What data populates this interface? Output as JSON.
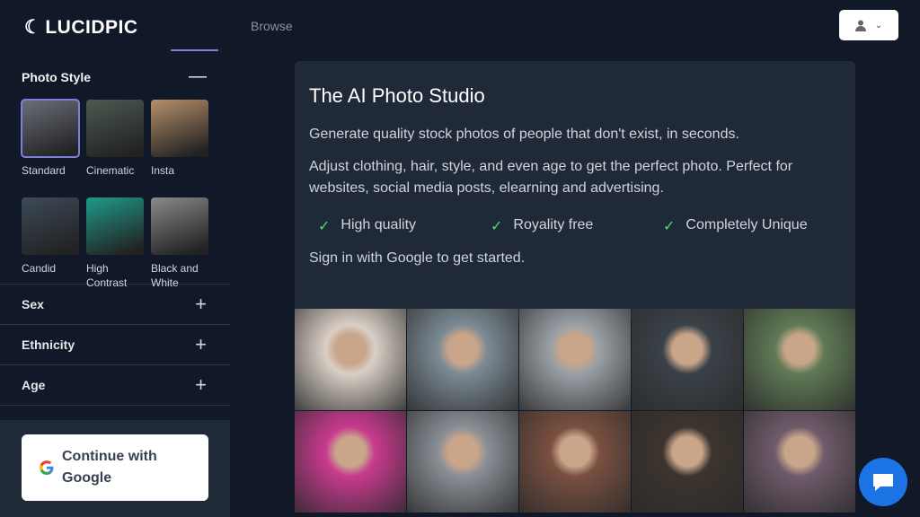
{
  "header": {
    "logo": "LUCIDPIC",
    "nav_browse": "Browse",
    "user_icon": "user-icon"
  },
  "sidebar": {
    "photo_style": {
      "title": "Photo Style",
      "styles": [
        {
          "label": "Standard",
          "selected": true,
          "color": "#6b6f7a"
        },
        {
          "label": "Cinematic",
          "color": "#4d5a52"
        },
        {
          "label": "Insta",
          "color": "#b7906a"
        },
        {
          "label": "Candid",
          "color": "#3d4a58"
        },
        {
          "label": "High Contrast",
          "color": "#1f9a8a"
        },
        {
          "label": "Black and White",
          "color": "#8a8a8a"
        }
      ]
    },
    "sections": [
      {
        "label": "Sex"
      },
      {
        "label": "Ethnicity"
      },
      {
        "label": "Age"
      }
    ],
    "google_button": "Continue with Google"
  },
  "main": {
    "title": "The AI Photo Studio",
    "intro": "Generate quality stock photos of people that don't exist, in seconds.",
    "description": "Adjust clothing, hair, style, and even age to get the perfect photo. Perfect for websites, social media posts, elearning and advertising.",
    "features": [
      "High quality",
      "Royality free",
      "Completely Unique"
    ],
    "cta": "Sign in with Google to get started.",
    "photo_colors": [
      "#d9cfc6",
      "#7b8a94",
      "#9aa0a6",
      "#3a4148",
      "#5f7a55",
      "#c83a8f",
      "#8a8f96",
      "#7a5040",
      "#3c342e",
      "#6f5b6a"
    ]
  },
  "colors": {
    "accent": "#7c7fe0",
    "background": "#111827",
    "card": "#1f2937",
    "check": "#4ade80",
    "chat": "#1b74e4"
  }
}
